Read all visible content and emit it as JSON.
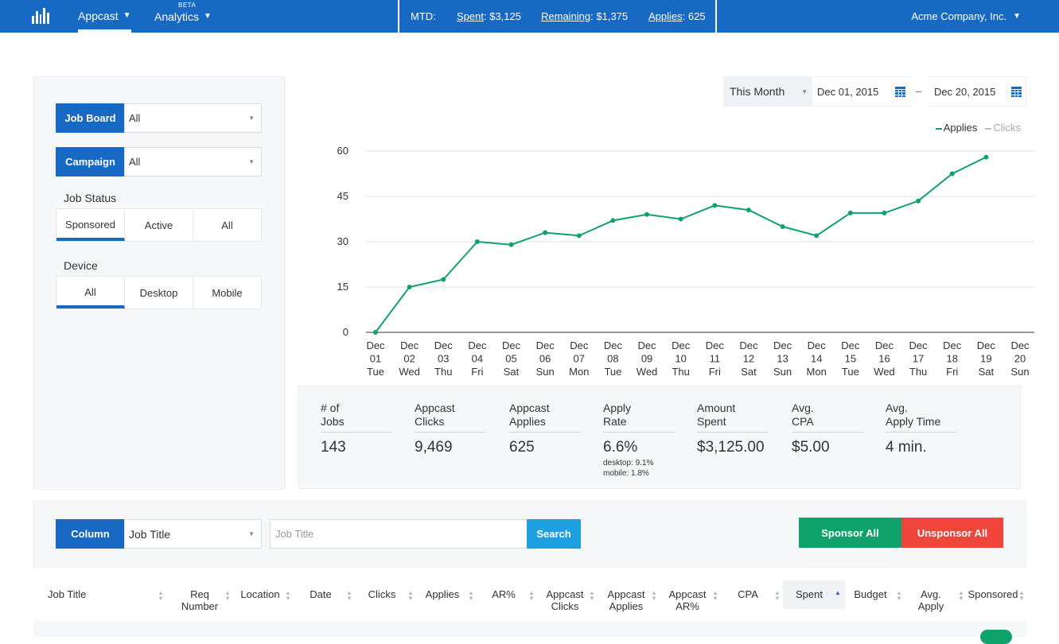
{
  "topbar": {
    "nav": [
      {
        "label": "Appcast"
      },
      {
        "label": "Analytics",
        "badge": "BETA"
      }
    ],
    "mtd_label": "MTD:",
    "spent_label": "Spent",
    "spent_value": ": $3,125",
    "remaining_label": "Remaining",
    "remaining_value": ": $1,375",
    "applies_label": "Applies",
    "applies_value": ": 625",
    "company": "Acme Company, Inc."
  },
  "filters": {
    "job_board": {
      "label": "Job Board",
      "value": "All"
    },
    "campaign": {
      "label": "Campaign",
      "value": "All"
    },
    "job_status": {
      "label": "Job Status",
      "options": [
        "Sponsored",
        "Active",
        "All"
      ],
      "selected": "Sponsored"
    },
    "device": {
      "label": "Device",
      "options": [
        "All",
        "Desktop",
        "Mobile"
      ],
      "selected": "All"
    }
  },
  "date_range": {
    "preset": "This Month",
    "start": "Dec 01, 2015",
    "separator": "–",
    "end": "Dec 20, 2015"
  },
  "legend": {
    "applies": "Applies",
    "clicks": "Clicks"
  },
  "chart_data": {
    "type": "line",
    "categories": [
      [
        "Dec",
        "01",
        "Tue"
      ],
      [
        "Dec",
        "02",
        "Wed"
      ],
      [
        "Dec",
        "03",
        "Thu"
      ],
      [
        "Dec",
        "04",
        "Fri"
      ],
      [
        "Dec",
        "05",
        "Sat"
      ],
      [
        "Dec",
        "06",
        "Sun"
      ],
      [
        "Dec",
        "07",
        "Mon"
      ],
      [
        "Dec",
        "08",
        "Tue"
      ],
      [
        "Dec",
        "09",
        "Wed"
      ],
      [
        "Dec",
        "10",
        "Thu"
      ],
      [
        "Dec",
        "11",
        "Fri"
      ],
      [
        "Dec",
        "12",
        "Sat"
      ],
      [
        "Dec",
        "13",
        "Sun"
      ],
      [
        "Dec",
        "14",
        "Mon"
      ],
      [
        "Dec",
        "15",
        "Tue"
      ],
      [
        "Dec",
        "16",
        "Wed"
      ],
      [
        "Dec",
        "17",
        "Thu"
      ],
      [
        "Dec",
        "18",
        "Fri"
      ],
      [
        "Dec",
        "19",
        "Sat"
      ],
      [
        "Dec",
        "20",
        "Sun"
      ]
    ],
    "series": [
      {
        "name": "Applies",
        "color": "#0fa36b",
        "values": [
          0,
          15,
          17.5,
          30,
          29,
          33,
          32,
          37,
          39,
          37.5,
          42,
          40.5,
          35,
          32,
          39.5,
          39.5,
          43.5,
          52.5,
          58
        ]
      }
    ],
    "yticks": [
      0,
      15,
      30,
      45,
      60
    ],
    "ylim": [
      0,
      60
    ],
    "grid": true,
    "legend_position": "top-right"
  },
  "stats": [
    {
      "title_1": "# of",
      "title_2": "Jobs",
      "value": "143"
    },
    {
      "title_1": "Appcast",
      "title_2": "Clicks",
      "value": "9,469"
    },
    {
      "title_1": "Appcast",
      "title_2": "Applies",
      "value": "625"
    },
    {
      "title_1": "Apply",
      "title_2": "Rate",
      "value": "6.6%",
      "sub_1": "desktop: 9.1%",
      "sub_2": "mobile: 1.8%"
    },
    {
      "title_1": "Amount",
      "title_2": "Spent",
      "value": "$3,125.00"
    },
    {
      "title_1": "Avg.",
      "title_2": "CPA",
      "value": "$5.00"
    },
    {
      "title_1": "Avg.",
      "title_2": "Apply Time",
      "value": "4 min."
    }
  ],
  "search": {
    "column_label": "Column",
    "column_value": "Job Title",
    "placeholder": "Job Title",
    "search_label": "Search",
    "sponsor_all": "Sponsor All",
    "unsponsor_all": "Unsponsor All"
  },
  "table": {
    "headers": [
      {
        "l1": "Job Title",
        "l2": ""
      },
      {
        "l1": "Req",
        "l2": "Number"
      },
      {
        "l1": "Location",
        "l2": ""
      },
      {
        "l1": "Date",
        "l2": ""
      },
      {
        "l1": "Clicks",
        "l2": ""
      },
      {
        "l1": "Applies",
        "l2": ""
      },
      {
        "l1": "AR%",
        "l2": ""
      },
      {
        "l1": "Appcast",
        "l2": "Clicks"
      },
      {
        "l1": "Appcast",
        "l2": "Applies"
      },
      {
        "l1": "Appcast",
        "l2": "AR%"
      },
      {
        "l1": "CPA",
        "l2": ""
      },
      {
        "l1": "Spent",
        "l2": ""
      },
      {
        "l1": "Budget",
        "l2": ""
      },
      {
        "l1": "Avg.",
        "l2": "Apply"
      },
      {
        "l1": "Sponsored",
        "l2": ""
      }
    ]
  },
  "colors": {
    "brand": "#1769c4",
    "applies_line": "#0fa36b",
    "search": "#1e9fe2",
    "sponsor": "#0fa36b",
    "unsponsor": "#f0453a"
  }
}
